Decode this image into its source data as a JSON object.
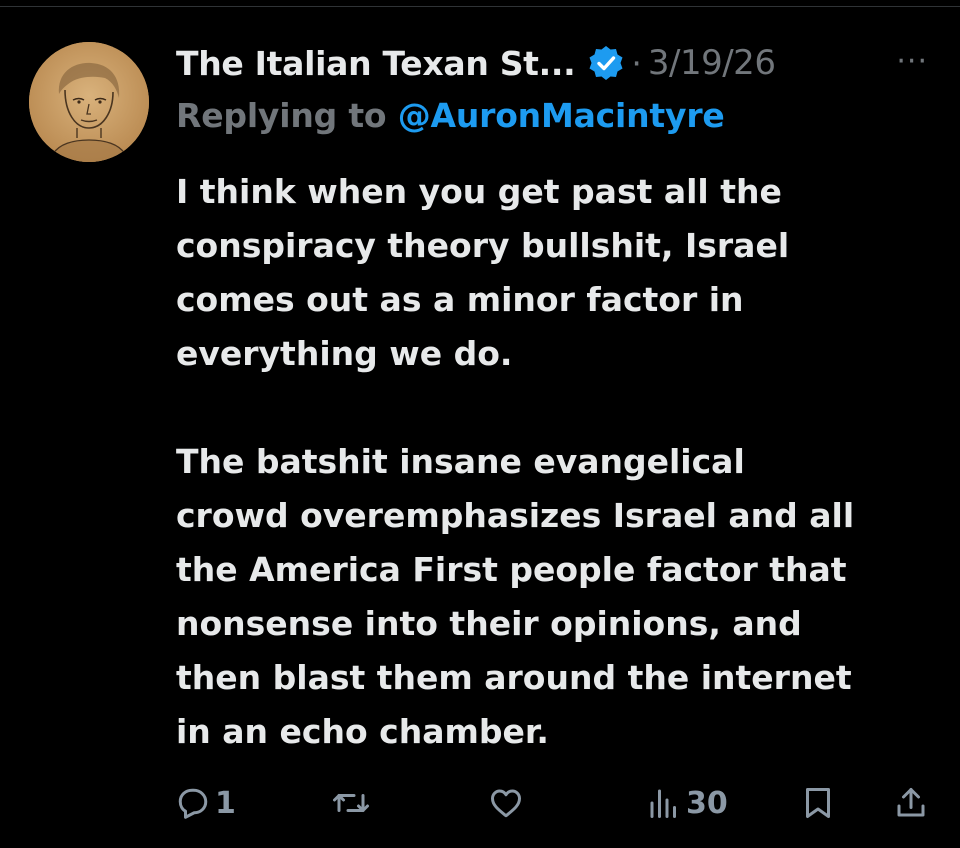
{
  "tweet": {
    "author_name": "The Italian Texan St...",
    "separator": "·",
    "date": "3/19/26",
    "more_label": "···",
    "reply_prefix": "Replying to ",
    "reply_handle": "@AuronMacintyre",
    "paragraphs": [
      "I think when you get past all the\nconspiracy theory bullshit, Israel\ncomes out as a minor factor in\neverything we do.",
      "The batshit insane evangelical\ncrowd overemphasizes Israel and all\nthe America First people factor that\nnonsense into their opinions, and\nthen blast them around the internet\nin an echo chamber."
    ]
  },
  "actions": {
    "reply_icon": "reply-icon",
    "reply_count": "1",
    "repost_icon": "repost-icon",
    "like_icon": "heart-icon",
    "views_icon": "views-icon",
    "views_count": "30",
    "bookmark_icon": "bookmark-icon",
    "share_icon": "share-icon"
  },
  "colors": {
    "background": "#000000",
    "text": "#e7e9ea",
    "muted": "#71767b",
    "accent": "#1d9bf0"
  }
}
